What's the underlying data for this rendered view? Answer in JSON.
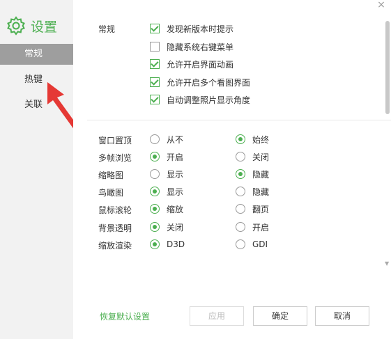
{
  "window": {
    "title": "设置",
    "close_glyph": "×"
  },
  "sidebar": {
    "items": [
      {
        "label": "常规",
        "active": true
      },
      {
        "label": "热键",
        "active": false
      },
      {
        "label": "关联",
        "active": false
      }
    ]
  },
  "general": {
    "section_label": "常规",
    "checkboxes": [
      {
        "label": "发现新版本时提示",
        "checked": true
      },
      {
        "label": "隐藏系统右键菜单",
        "checked": false
      },
      {
        "label": "允许开启界面动画",
        "checked": true
      },
      {
        "label": "允许开启多个看图界面",
        "checked": true
      },
      {
        "label": "自动调整照片显示角度",
        "checked": true
      }
    ]
  },
  "options": [
    {
      "label": "窗口置顶",
      "choices": [
        "从不",
        "始终"
      ],
      "selected": 1
    },
    {
      "label": "多帧浏览",
      "choices": [
        "开启",
        "关闭"
      ],
      "selected": 0
    },
    {
      "label": "缩略图",
      "choices": [
        "显示",
        "隐藏"
      ],
      "selected": 1
    },
    {
      "label": "鸟瞰图",
      "choices": [
        "显示",
        "隐藏"
      ],
      "selected": 0
    },
    {
      "label": "鼠标滚轮",
      "choices": [
        "缩放",
        "翻页"
      ],
      "selected": 0
    },
    {
      "label": "背景透明",
      "choices": [
        "关闭",
        "开启"
      ],
      "selected": 0
    },
    {
      "label": "缩放渲染",
      "choices": [
        "D3D",
        "GDI"
      ],
      "selected": 0
    }
  ],
  "footer": {
    "restore_label": "恢复默认设置",
    "apply_label": "应用",
    "ok_label": "确定",
    "cancel_label": "取消"
  },
  "colors": {
    "accent": "#4caf50",
    "sidebar_bg": "#f2f2f2",
    "active_item_bg": "#9e9e9e",
    "arrow": "#e53935"
  }
}
